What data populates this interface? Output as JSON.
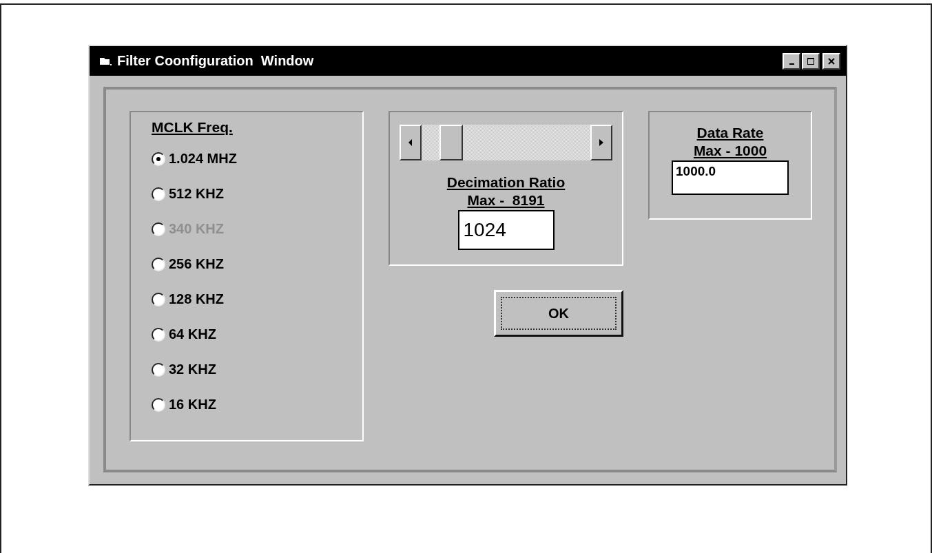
{
  "window": {
    "title": "Filter Coonfiguration  Window"
  },
  "mclk": {
    "heading": "MCLK Freq.",
    "options": [
      {
        "label": "1.024 MHZ",
        "selected": true,
        "disabled": false
      },
      {
        "label": "512 KHZ",
        "selected": false,
        "disabled": false
      },
      {
        "label": "340 KHZ",
        "selected": false,
        "disabled": true
      },
      {
        "label": "256 KHZ",
        "selected": false,
        "disabled": false
      },
      {
        "label": "128 KHZ",
        "selected": false,
        "disabled": false
      },
      {
        "label": "64 KHZ",
        "selected": false,
        "disabled": false
      },
      {
        "label": "32 KHZ",
        "selected": false,
        "disabled": false
      },
      {
        "label": "16 KHZ",
        "selected": false,
        "disabled": false
      }
    ]
  },
  "decimation": {
    "slider": {
      "level": 0.125
    },
    "heading": "Decimation Ratio",
    "max": "Max -  8191",
    "value": "1024"
  },
  "data_rate": {
    "heading": "Data Rate",
    "max": "Max - 1000",
    "value": "1000.0"
  },
  "ok_button": {
    "label": "OK"
  }
}
